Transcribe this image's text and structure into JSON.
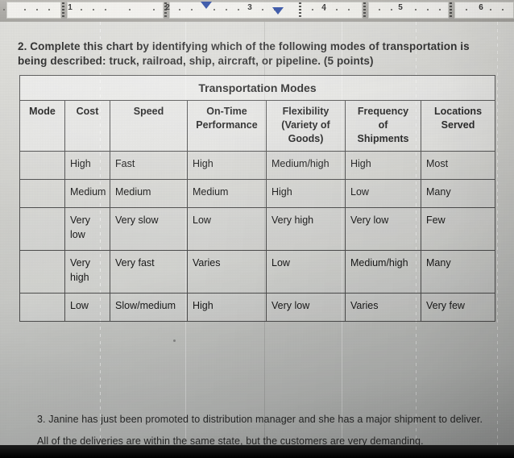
{
  "ruler": {
    "numbers": [
      "1",
      "2",
      "3",
      "4",
      "5",
      "6"
    ],
    "left_indent_marker": "first-line-indent-marker",
    "right_indent_marker": "hanging-indent-marker"
  },
  "document": {
    "question_2": "2. Complete this chart by identifying which of the following modes of transportation is being described: truck, railroad, ship, aircraft, or pipeline. (5 points)",
    "question_3": "3. Janine has just been promoted to distribution manager and she has a major shipment to deliver. All of the deliveries are within the same state, but the customers are very demanding."
  },
  "table": {
    "title": "Transportation Modes",
    "headers": [
      "Mode",
      "Cost",
      "Speed",
      "On-Time Performance",
      "Flexibility (Variety of Goods)",
      "Frequency of Shipments",
      "Locations Served"
    ],
    "header_lines": [
      [
        "Mode"
      ],
      [
        "Cost"
      ],
      [
        "Speed"
      ],
      [
        "On-Time",
        "Performance"
      ],
      [
        "Flexibility",
        "(Variety of",
        "Goods)"
      ],
      [
        "Frequency",
        "of",
        "Shipments"
      ],
      [
        "Locations",
        "Served"
      ]
    ],
    "rows": [
      {
        "mode": "",
        "cost": "High",
        "speed": "Fast",
        "on_time": "High",
        "flexibility": "Medium/high",
        "frequency": "High",
        "locations": "Most"
      },
      {
        "mode": "",
        "cost": "Medium",
        "speed": "Medium",
        "on_time": "Medium",
        "flexibility": "High",
        "frequency": "Low",
        "locations": "Many"
      },
      {
        "mode": "",
        "cost": "Very low",
        "speed": "Very slow",
        "on_time": "Low",
        "flexibility": "Very high",
        "frequency": "Very low",
        "locations": "Few"
      },
      {
        "mode": "",
        "cost": "Very high",
        "speed": "Very fast",
        "on_time": "Varies",
        "flexibility": "Low",
        "frequency": "Medium/high",
        "locations": "Many"
      },
      {
        "mode": "",
        "cost": "Low",
        "speed": "Slow/medium",
        "on_time": "High",
        "flexibility": "Very low",
        "frequency": "Varies",
        "locations": "Very few"
      }
    ]
  },
  "colors": {
    "page_background": "#d2d2ce",
    "ruler_background": "#a9a7a2",
    "text": "#181818",
    "table_border": "#4c4c4c",
    "indent_marker": "#1d3f9e"
  }
}
